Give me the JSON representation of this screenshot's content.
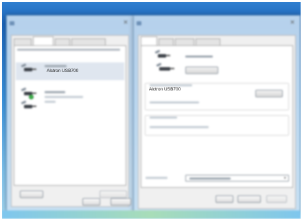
{
  "left_dialog": {
    "device_name": "Alctron USB700"
  },
  "right_dialog": {
    "device_name": "Alctron USB700"
  },
  "icons": {
    "device": "microphone-usb-icon",
    "default": "green-check-icon"
  },
  "colors": {
    "desktop_top": "#1c64b8",
    "desktop_bottom": "#a6d7f0",
    "window_frame": "#cce0f2",
    "default_check": "#3db34a"
  }
}
